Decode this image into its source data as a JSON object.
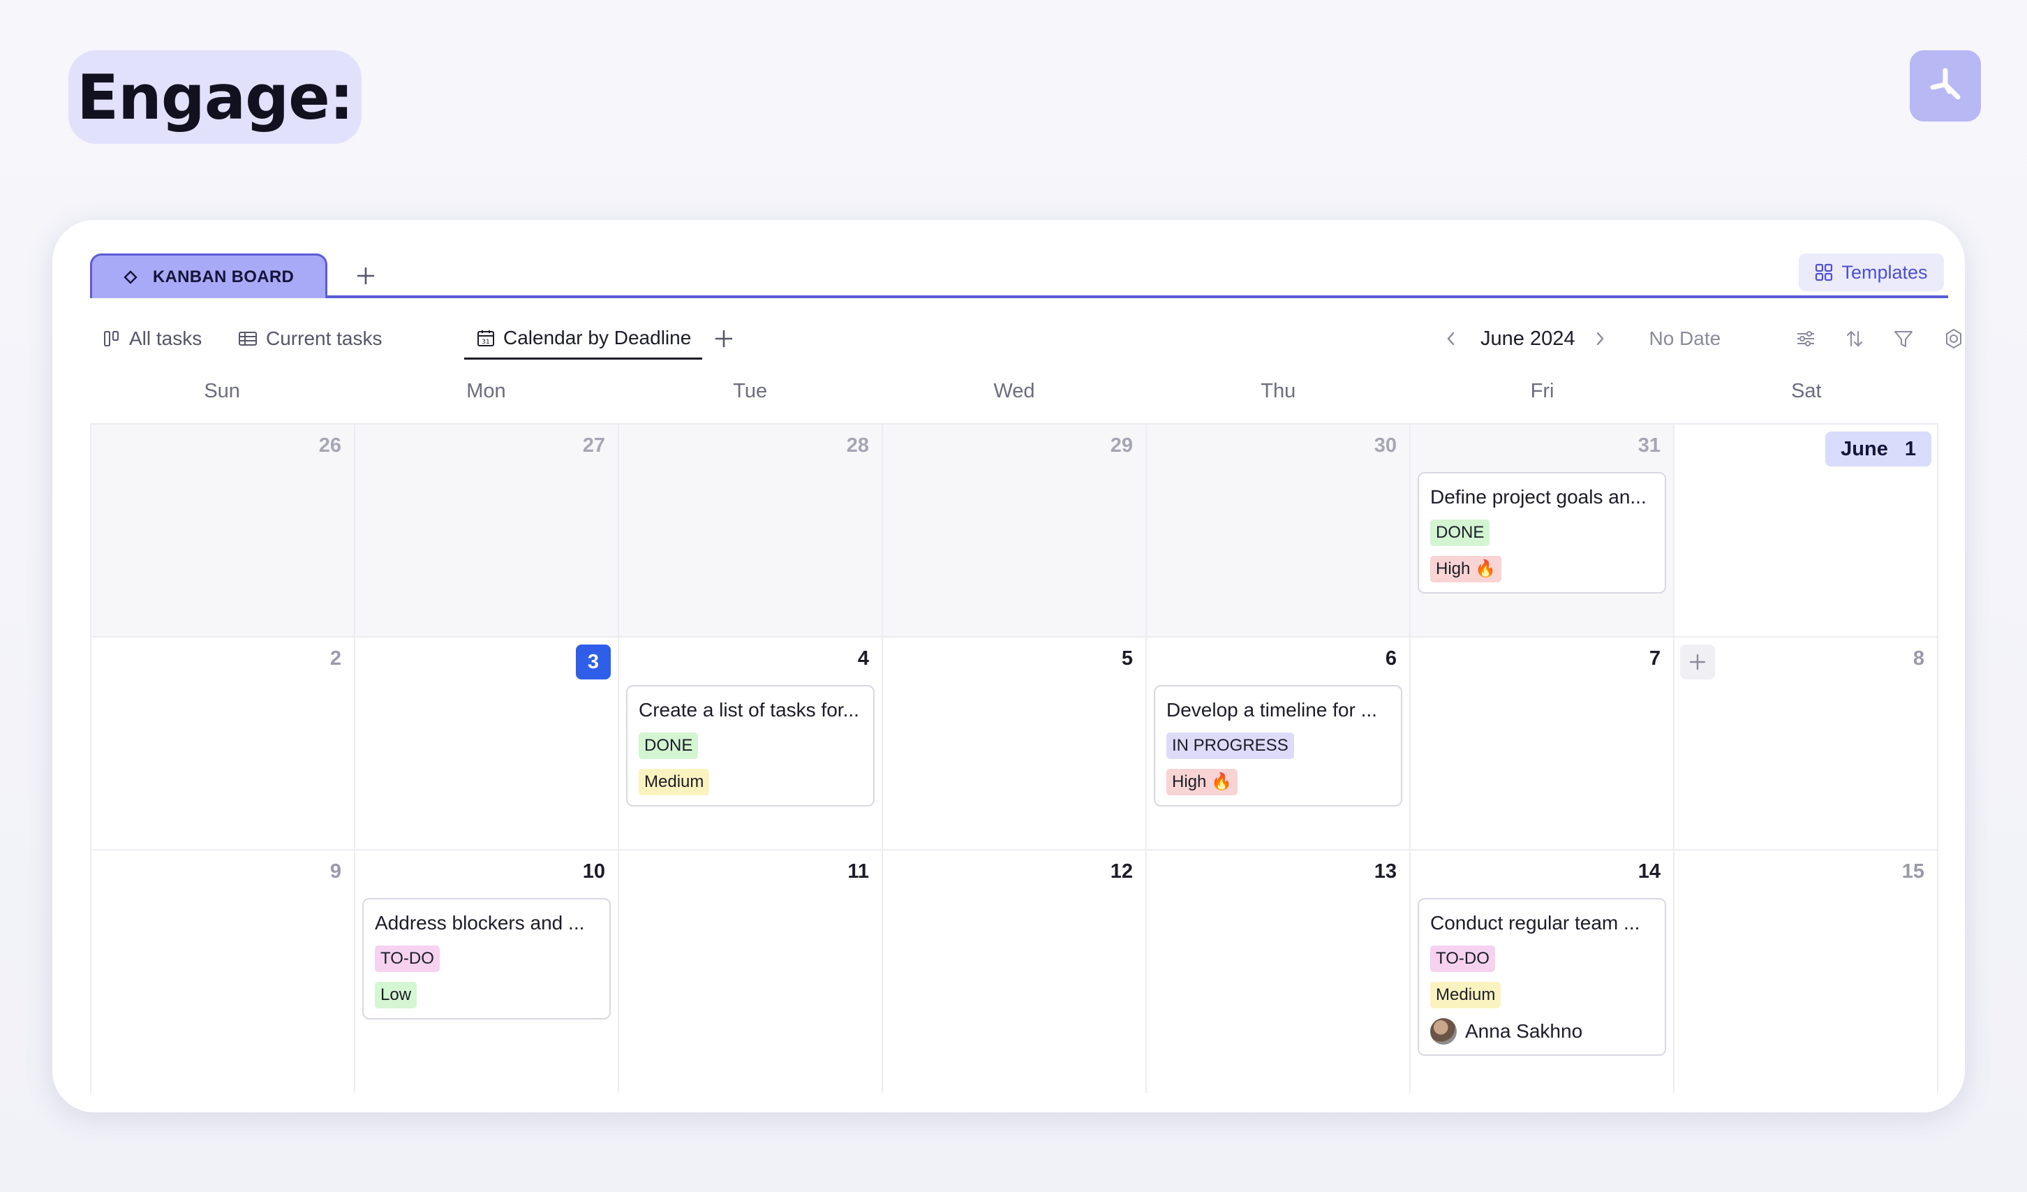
{
  "page": {
    "title": "Engage:"
  },
  "tabs": {
    "main_tab": "KANBAN BOARD",
    "templates_label": "Templates"
  },
  "views": [
    {
      "label": "All tasks",
      "icon": "board-icon"
    },
    {
      "label": "Current tasks",
      "icon": "table-icon"
    },
    {
      "label": "Calendar by Deadline",
      "icon": "calendar-icon",
      "active": true
    }
  ],
  "navigation": {
    "month": "June 2024",
    "no_date": "No Date"
  },
  "weekdays": [
    "Sun",
    "Mon",
    "Tue",
    "Wed",
    "Thu",
    "Fri",
    "Sat"
  ],
  "weeks": [
    {
      "days": [
        {
          "num": "26",
          "other": true
        },
        {
          "num": "27",
          "other": true
        },
        {
          "num": "28",
          "other": true
        },
        {
          "num": "29",
          "other": true
        },
        {
          "num": "30",
          "other": true
        },
        {
          "num": "31",
          "other": true,
          "task": {
            "title": "Define project goals an...",
            "status": "DONE",
            "priority": "High 🔥"
          }
        },
        {
          "num": "1",
          "month_label": "June"
        }
      ]
    },
    {
      "days": [
        {
          "num": "2"
        },
        {
          "num": "3",
          "today": true
        },
        {
          "num": "4",
          "task": {
            "title": "Create a list of tasks for...",
            "status": "DONE",
            "priority": "Medium"
          }
        },
        {
          "num": "5"
        },
        {
          "num": "6",
          "task": {
            "title": "Develop a timeline for ...",
            "status": "IN PROGRESS",
            "priority": "High 🔥"
          }
        },
        {
          "num": "7"
        },
        {
          "num": "8"
        }
      ]
    },
    {
      "days": [
        {
          "num": "9"
        },
        {
          "num": "10",
          "task": {
            "title": "Address blockers and ...",
            "status": "TO-DO",
            "priority": "Low"
          }
        },
        {
          "num": "11"
        },
        {
          "num": "12"
        },
        {
          "num": "13"
        },
        {
          "num": "14",
          "task": {
            "title": "Conduct regular team ...",
            "status": "TO-DO",
            "priority": "Medium",
            "assignee": "Anna Sakhno"
          }
        },
        {
          "num": "15"
        }
      ]
    }
  ],
  "colors": {
    "accent": "#5a5cd6",
    "today": "#2f5ee8",
    "tab_bg": "#a9aaf7"
  }
}
